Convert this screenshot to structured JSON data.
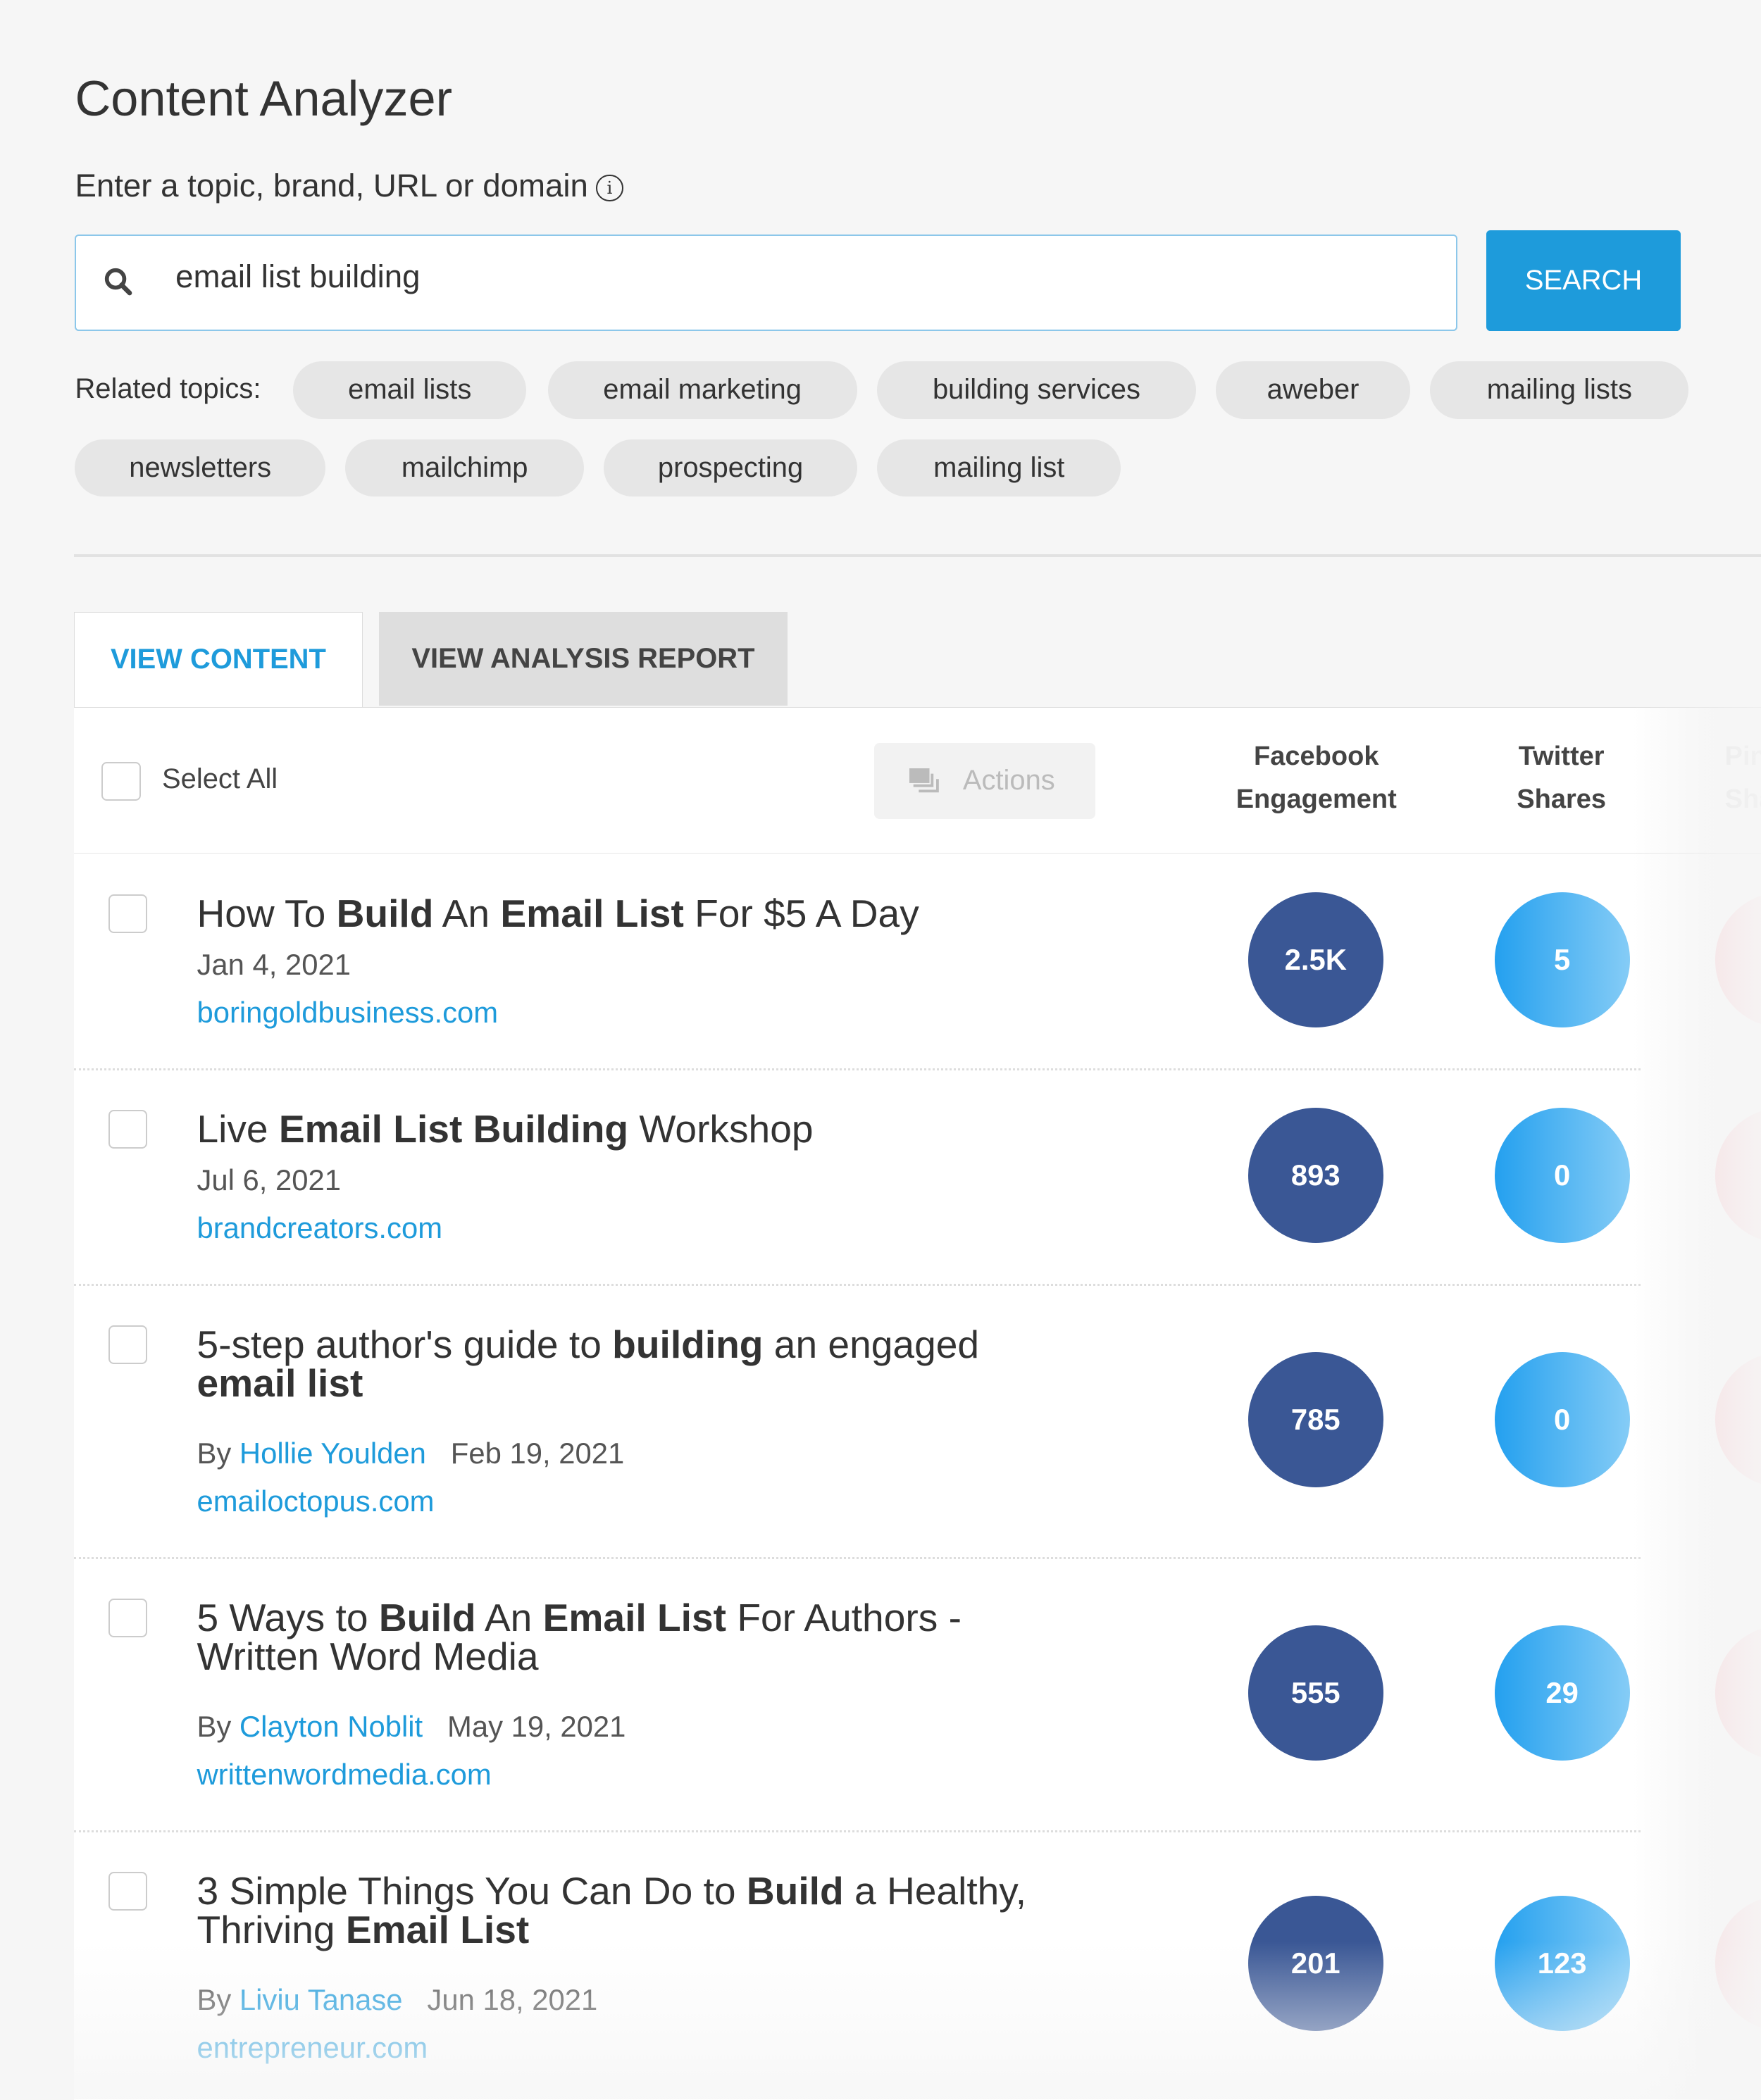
{
  "header": {
    "title": "Content Analyzer",
    "subtitle": "Enter a topic, brand, URL or domain",
    "info_icon": "info-icon"
  },
  "search": {
    "value": "email list building",
    "button": "SEARCH"
  },
  "related": {
    "label": "Related topics:",
    "topics": [
      "email lists",
      "email marketing",
      "building services",
      "aweber",
      "mailing lists",
      "newsletters",
      "mailchimp",
      "prospecting",
      "mailing list"
    ]
  },
  "tabs": [
    {
      "label": "VIEW CONTENT",
      "active": true
    },
    {
      "label": "VIEW ANALYSIS REPORT",
      "active": false
    }
  ],
  "table": {
    "select_all": "Select All",
    "actions": "Actions",
    "columns": [
      {
        "l1": "Facebook",
        "l2": "Engagement"
      },
      {
        "l1": "Twitter",
        "l2": "Shares"
      },
      {
        "l1": "Pinterest",
        "l2": "Shares"
      }
    ],
    "colors": {
      "facebook": "#3a5795",
      "twitter": "#24a0ef",
      "pinterest": "#f5dcdf",
      "link": "#1e9bdb"
    },
    "rows": [
      {
        "title": [
          [
            "How To ",
            0
          ],
          [
            "Build",
            1
          ],
          [
            " An ",
            0
          ],
          [
            "Email List",
            1
          ],
          [
            " For $5 A Day",
            0
          ]
        ],
        "author": "",
        "date": "Jan 4, 2021",
        "domain": "boringoldbusiness.com",
        "facebook": "2.5K",
        "twitter": "5"
      },
      {
        "title": [
          [
            "Live ",
            0
          ],
          [
            "Email List Building",
            1
          ],
          [
            " Workshop",
            0
          ]
        ],
        "author": "",
        "date": "Jul 6, 2021",
        "domain": "brandcreators.com",
        "facebook": "893",
        "twitter": "0"
      },
      {
        "title": [
          [
            "5-step author's guide to ",
            0
          ],
          [
            "building",
            1
          ],
          [
            " an engaged ",
            0
          ],
          [
            "email list",
            1
          ]
        ],
        "by": "By",
        "author": "Hollie Youlden",
        "date": "Feb 19, 2021",
        "domain": "emailoctopus.com",
        "facebook": "785",
        "twitter": "0"
      },
      {
        "title": [
          [
            "5 Ways to ",
            0
          ],
          [
            "Build",
            1
          ],
          [
            " An ",
            0
          ],
          [
            "Email List",
            1
          ],
          [
            " For Authors - Written Word Media",
            0
          ]
        ],
        "by": "By",
        "author": "Clayton Noblit",
        "date": "May 19, 2021",
        "domain": "writtenwordmedia.com",
        "facebook": "555",
        "twitter": "29"
      },
      {
        "title": [
          [
            "3 Simple Things You Can Do to ",
            0
          ],
          [
            "Build",
            1
          ],
          [
            " a Healthy, Thriving ",
            0
          ],
          [
            "Email List",
            1
          ]
        ],
        "by": "By",
        "author": "Liviu Tanase",
        "date": "Jun 18, 2021",
        "domain": "entrepreneur.com",
        "facebook": "201",
        "twitter": "123"
      }
    ]
  }
}
